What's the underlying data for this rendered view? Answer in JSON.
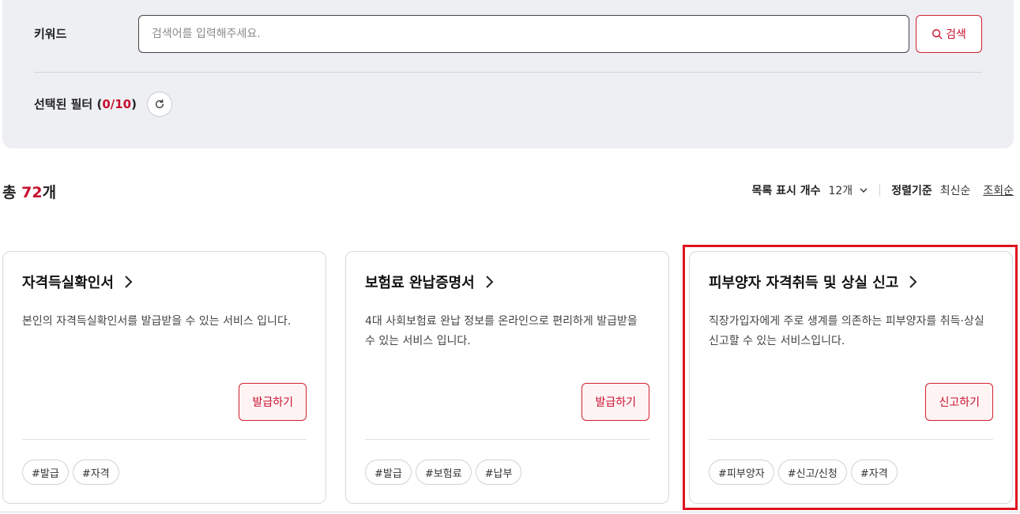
{
  "search": {
    "keyword_label": "키워드",
    "placeholder": "검색어를 입력해주세요.",
    "value": "",
    "button_label": "검색"
  },
  "filters": {
    "label_prefix": "선택된 필터 (",
    "selected_count": "0/10",
    "label_suffix": ")"
  },
  "results": {
    "total_prefix": "총 ",
    "total_count": "72",
    "total_suffix": "개",
    "page_size_label": "목록 표시 개수",
    "page_size_value": "12개",
    "sort_label": "정렬기준",
    "sort_options": [
      "최신순",
      "조회순"
    ]
  },
  "cards": [
    {
      "title": "자격득실확인서",
      "description": "본인의 자격득실확인서를 발급받을 수 있는 서비스 입니다.",
      "action": "발급하기",
      "tags": [
        "#발급",
        "#자격"
      ]
    },
    {
      "title": "보험료 완납증명서",
      "description": "4대 사회보험료 완납 정보를 온라인으로 편리하게 발급받을 수 있는 서비스 입니다.",
      "action": "발급하기",
      "tags": [
        "#발급",
        "#보험료",
        "#납부"
      ]
    },
    {
      "title": "피부양자 자격취득 및 상실 신고",
      "description": "직장가입자에게 주로 생계를 의존하는 피부양자를 취득·상실 신고할 수 있는 서비스입니다.",
      "action": "신고하기",
      "tags": [
        "#피부양자",
        "#신고/신청",
        "#자격"
      ]
    }
  ],
  "colors": {
    "accent": "#c8102e",
    "panel_bg": "#edeff3",
    "highlight": "#e0131f"
  },
  "icons": {
    "search": "search-icon",
    "refresh": "refresh-icon",
    "dropdown": "chevron-down-icon",
    "card_link": "chevron-right-icon"
  }
}
